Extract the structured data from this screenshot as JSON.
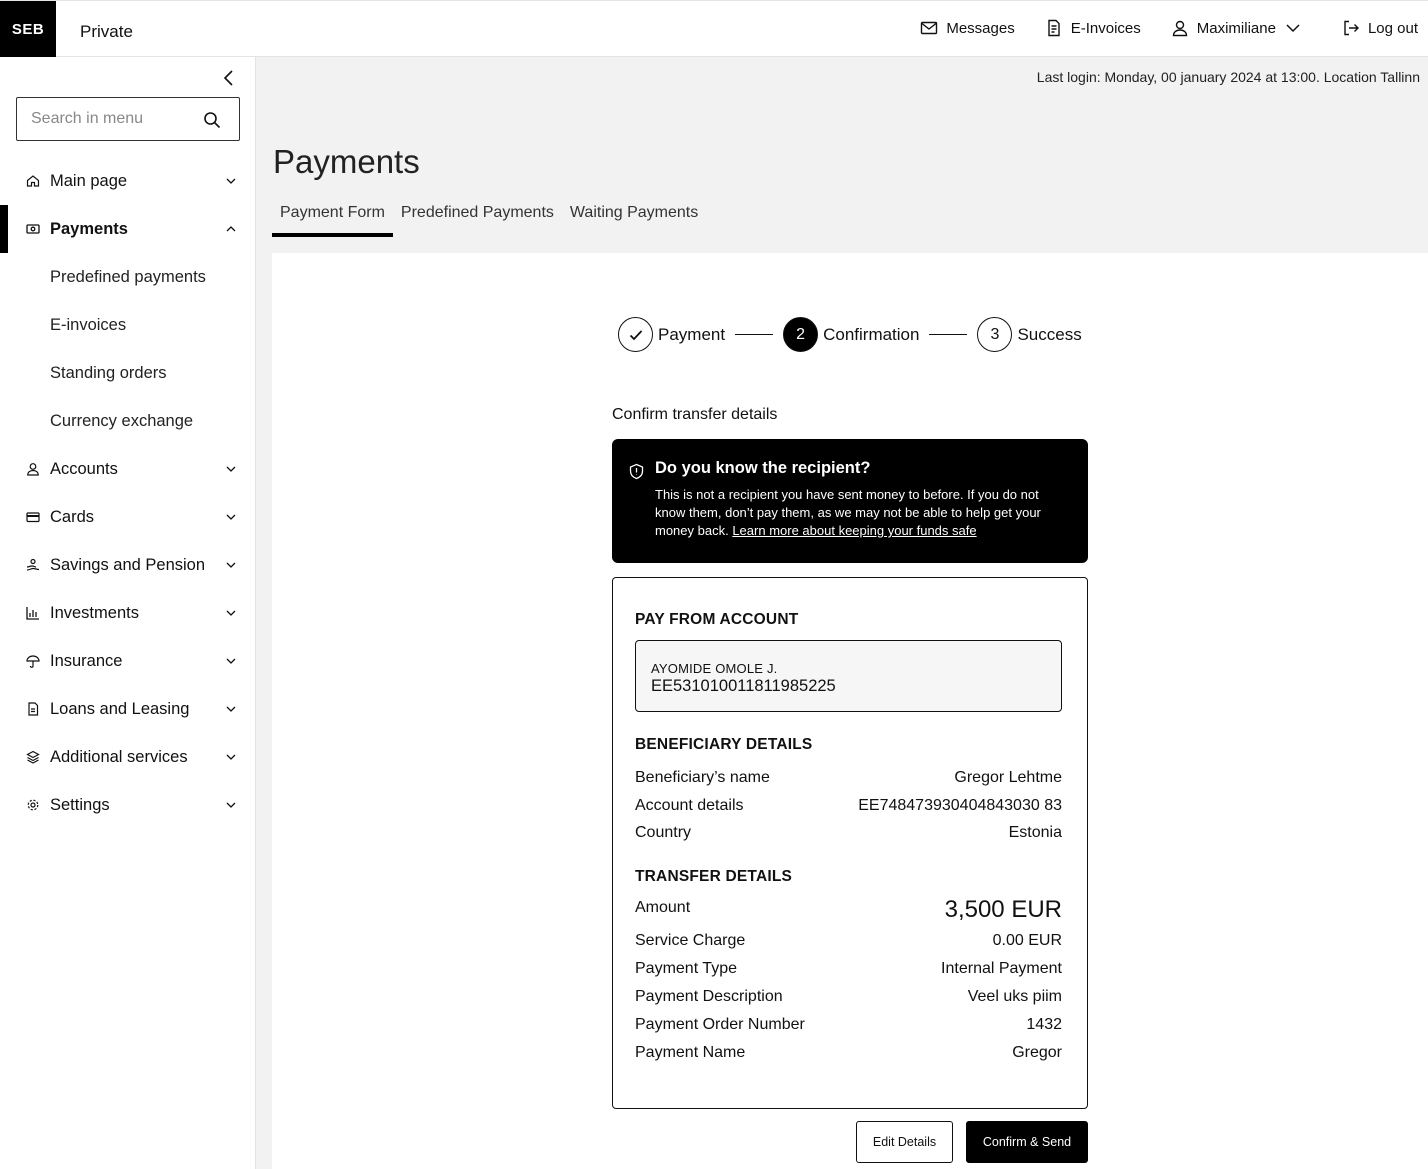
{
  "header": {
    "logo_text": "SEB",
    "brand_label": "Private",
    "messages": "Messages",
    "einvoices": "E-Invoices",
    "user": "Maximiliane",
    "logout": "Log out"
  },
  "sidebar": {
    "search_placeholder": "Search in menu",
    "items": [
      {
        "label": "Main page",
        "icon": "home-icon"
      },
      {
        "label": "Payments",
        "icon": "payments-icon",
        "active": true,
        "children": [
          "Predefined payments",
          "E-invoices",
          "Standing orders",
          "Currency exchange"
        ]
      },
      {
        "label": "Accounts",
        "icon": "user-icon"
      },
      {
        "label": "Cards",
        "icon": "card-icon"
      },
      {
        "label": "Savings and Pension",
        "icon": "savings-icon"
      },
      {
        "label": "Investments",
        "icon": "chart-icon"
      },
      {
        "label": "Insurance",
        "icon": "umbrella-icon"
      },
      {
        "label": "Loans and Leasing",
        "icon": "document-icon"
      },
      {
        "label": "Additional services",
        "icon": "layers-icon"
      },
      {
        "label": "Settings",
        "icon": "gear-icon"
      }
    ]
  },
  "last_login": "Last login: Monday, 00 january 2024 at 13:00. Location Tallinn",
  "page_title": "Payments",
  "tabs": [
    "Payment Form",
    "Predefined Payments",
    "Waiting Payments"
  ],
  "stepper": {
    "steps": [
      {
        "label": "Payment",
        "marker": "check-icon"
      },
      {
        "label": "Confirmation",
        "number": "2"
      },
      {
        "label": "Success",
        "number": "3"
      }
    ]
  },
  "confirm_title": "Confirm transfer details",
  "alert": {
    "title": "Do you know the recipient?",
    "body": "This is not a recipient you have sent money to before. If you do not know them, don’t pay them, as we may not be able to help get your money back. ",
    "link": "Learn more about keeping your funds safe"
  },
  "pay_from": {
    "title": "PAY FROM ACCOUNT",
    "name": "AYOMIDE OMOLE J.",
    "iban": "EE531010011811985225"
  },
  "beneficiary": {
    "title": "BENEFICIARY DETAILS",
    "rows": [
      {
        "label": "Beneficiary’s name",
        "value": "Gregor Lehtme"
      },
      {
        "label": "Account details",
        "value": "EE748473930404843030 83"
      },
      {
        "label": "Country",
        "value": "Estonia"
      }
    ]
  },
  "transfer": {
    "title": "TRANSFER DETAILS",
    "rows": [
      {
        "label": "Amount",
        "value": "3,500 EUR"
      },
      {
        "label": "Service Charge",
        "value": "0.00 EUR"
      },
      {
        "label": "Payment Type",
        "value": "Internal Payment"
      },
      {
        "label": "Payment Description",
        "value": "Veel uks piim"
      },
      {
        "label": "Payment Order Number",
        "value": "1432"
      },
      {
        "label": "Payment Name",
        "value": "Gregor"
      }
    ]
  },
  "buttons": {
    "edit": "Edit Details",
    "confirm": "Confirm & Send"
  }
}
